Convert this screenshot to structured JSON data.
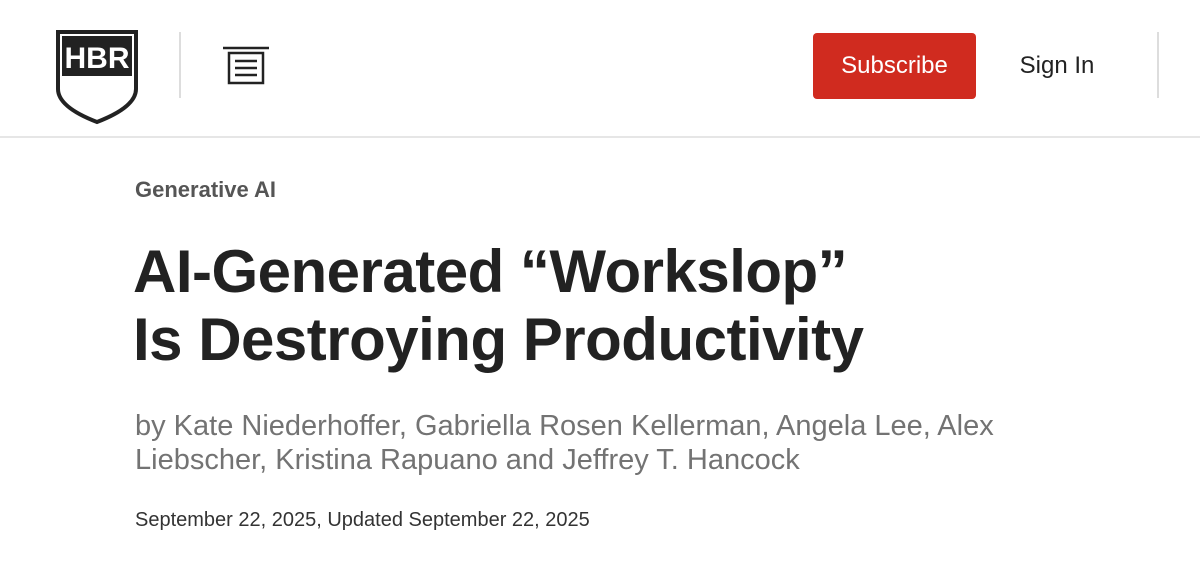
{
  "header": {
    "logo_text": "HBR",
    "menu_icon": "menu-icon",
    "subscribe_label": "Subscribe",
    "signin_label": "Sign In",
    "colors": {
      "subscribe_bg": "#d02b1f",
      "logo": "#222222"
    }
  },
  "article": {
    "topic": "Generative AI",
    "title_line1": "AI-Generated “Workslop”",
    "title_line2": "Is Destroying Productivity",
    "byline_line1": "by Kate Niederhoffer, Gabriella Rosen Kellerman, Angela Lee, Alex",
    "byline_line2": "Liebscher, Kristina Rapuano and Jeffrey T. Hancock",
    "dates": "September 22, 2025, Updated September 22, 2025"
  }
}
